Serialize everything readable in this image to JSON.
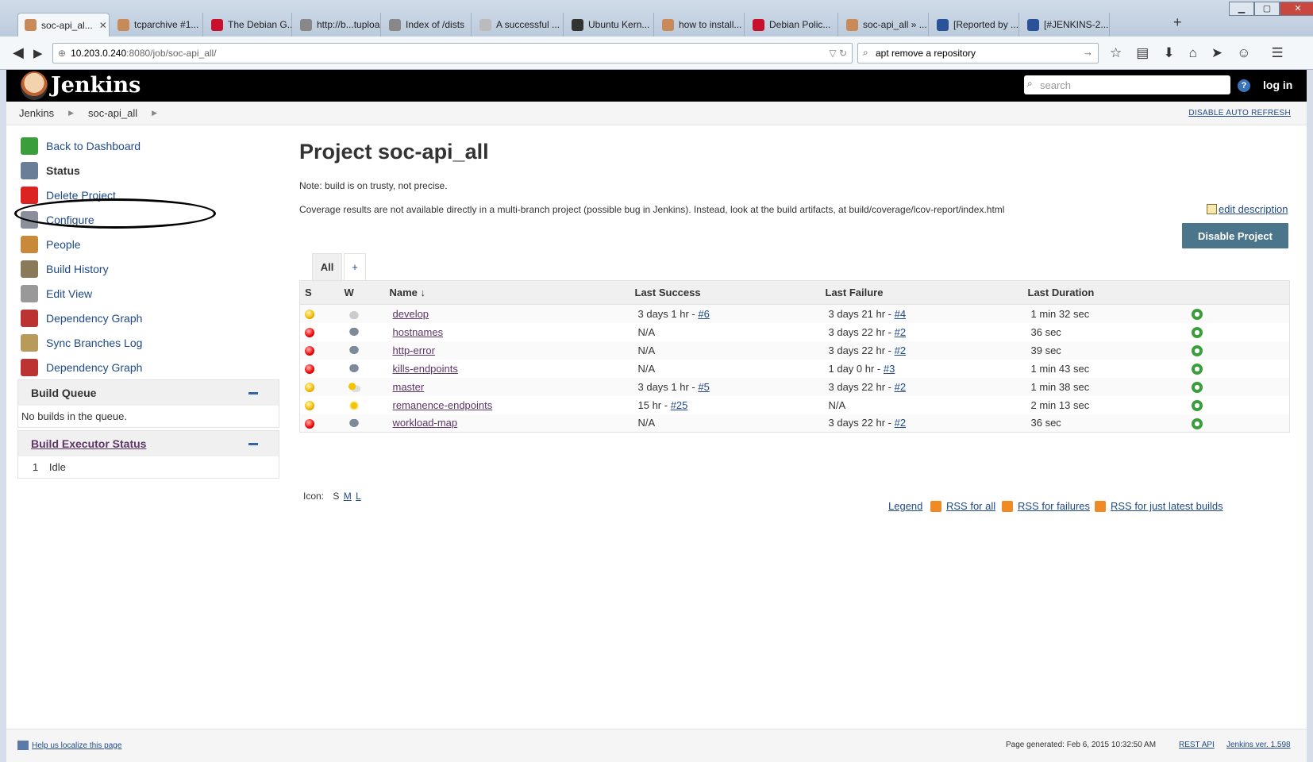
{
  "browser": {
    "tabs": [
      {
        "label": "soc-api_al...",
        "active": true
      },
      {
        "label": "tcparchive #1..."
      },
      {
        "label": "The Debian G..."
      },
      {
        "label": "http://b...tuploads"
      },
      {
        "label": "Index of /dists"
      },
      {
        "label": "A successful ..."
      },
      {
        "label": "Ubuntu Kern..."
      },
      {
        "label": "how to install..."
      },
      {
        "label": "Debian Polic..."
      },
      {
        "label": "soc-api_all » ..."
      },
      {
        "label": "[Reported by ..."
      },
      {
        "label": "[#JENKINS-2..."
      }
    ],
    "url_host": "10.203.0.240",
    "url_path": ":8080/job/soc-api_all/",
    "search_value": "apt remove a repository"
  },
  "jenkins": {
    "title": "Jenkins",
    "search_placeholder": "search",
    "help": "?",
    "login": "log in",
    "breadcrumbs": [
      "Jenkins",
      "soc-api_all"
    ],
    "disable_auto_refresh": "DISABLE AUTO REFRESH"
  },
  "sidebar": {
    "items": [
      {
        "label": "Back to Dashboard",
        "icon": "up-arrow-icon",
        "color": "#3a9f3a"
      },
      {
        "label": "Status",
        "icon": "magnifier-icon",
        "color": "#6a7f97"
      },
      {
        "label": "Delete Project",
        "icon": "no-entry-icon",
        "color": "#d22"
      },
      {
        "label": "Configure",
        "icon": "wrench-icon",
        "color": "#8a8f99"
      },
      {
        "label": "People",
        "icon": "people-icon",
        "color": "#c9893a"
      },
      {
        "label": "Build History",
        "icon": "notepad-icon",
        "color": "#8a7a5a"
      },
      {
        "label": "Edit View",
        "icon": "gear-icon",
        "color": "#999"
      },
      {
        "label": "Dependency Graph",
        "icon": "graph-icon",
        "color": "#b33"
      },
      {
        "label": "Sync Branches Log",
        "icon": "clipboard-icon",
        "color": "#b89a5a"
      },
      {
        "label": "Dependency Graph",
        "icon": "graph-icon",
        "color": "#b33"
      }
    ]
  },
  "build_queue": {
    "title": "Build Queue",
    "body": "No builds in the queue."
  },
  "executors": {
    "title": "Build Executor Status",
    "index": "1",
    "state": "Idle"
  },
  "main": {
    "title": "Project soc-api_all",
    "note": "Note: build is on trusty, not precise.",
    "note2": "Coverage results are not available directly in a multi-branch project (possible bug in Jenkins).  Instead, look at the build artifacts, at build/coverage/lcov-report/index.html",
    "edit_description": "edit description",
    "disable_button": "Disable Project",
    "tab_all": "All",
    "tab_add": "+",
    "columns": {
      "s": "S",
      "w": "W",
      "name": "Name",
      "sort": "↓",
      "last_success": "Last Success",
      "last_failure": "Last Failure",
      "last_duration": "Last Duration"
    },
    "rows": [
      {
        "status": "yellow",
        "weather": "cloudy",
        "name": "develop",
        "ls": "3 days 1 hr - ",
        "ls_link": "#6",
        "lf": "3 days 21 hr - ",
        "lf_link": "#4",
        "dur": "1 min 32 sec"
      },
      {
        "status": "red",
        "weather": "storm",
        "name": "hostnames",
        "ls": "N/A",
        "ls_link": "",
        "lf": "3 days 22 hr - ",
        "lf_link": "#2",
        "dur": "36 sec"
      },
      {
        "status": "red",
        "weather": "storm",
        "name": "http-error",
        "ls": "N/A",
        "ls_link": "",
        "lf": "3 days 22 hr - ",
        "lf_link": "#2",
        "dur": "39 sec"
      },
      {
        "status": "red",
        "weather": "storm",
        "name": "kills-endpoints",
        "ls": "N/A",
        "ls_link": "",
        "lf": "1 day 0 hr - ",
        "lf_link": "#3",
        "dur": "1 min 43 sec"
      },
      {
        "status": "yellow",
        "weather": "partly",
        "name": "master",
        "ls": "3 days 1 hr - ",
        "ls_link": "#5",
        "lf": "3 days 22 hr - ",
        "lf_link": "#2",
        "dur": "1 min 38 sec"
      },
      {
        "status": "yellow",
        "weather": "sun",
        "name": "remanence-endpoints",
        "ls": "15 hr - ",
        "ls_link": "#25",
        "lf": "N/A",
        "lf_link": "",
        "dur": "2 min 13 sec"
      },
      {
        "status": "red",
        "weather": "storm",
        "name": "workload-map",
        "ls": "N/A",
        "ls_link": "",
        "lf": "3 days 22 hr - ",
        "lf_link": "#2",
        "dur": "36 sec"
      }
    ],
    "icon_label": "Icon:",
    "icon_sizes": [
      "S",
      "M",
      "L"
    ],
    "legend": "Legend",
    "rss_all": "RSS for all",
    "rss_failures": "RSS for failures",
    "rss_latest": "RSS for just latest builds"
  },
  "footer": {
    "localize": "Help us localize this page",
    "generated": "Page generated: Feb 6, 2015 10:32:50 AM",
    "rest_api": "REST API",
    "version": "Jenkins ver. 1.598"
  }
}
